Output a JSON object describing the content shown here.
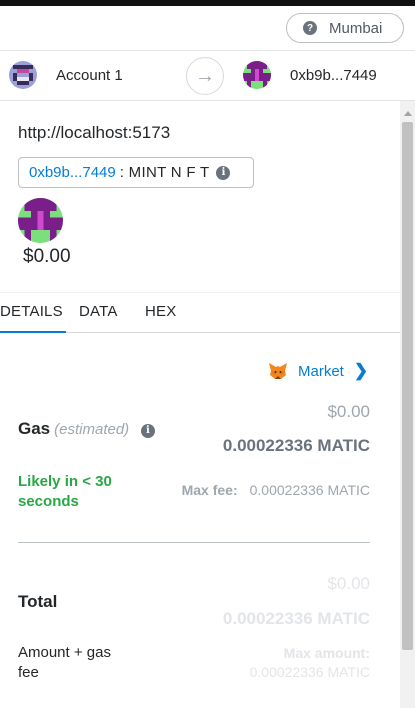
{
  "network": {
    "label": "Mumbai",
    "help_glyph": "?"
  },
  "accounts": {
    "from_label": "Account 1",
    "to_label": "0xb9b...7449",
    "arrow_glyph": "→"
  },
  "request": {
    "origin": "http://localhost:5173",
    "contract_address": "0xb9b...7449",
    "method": ": MINT N F T",
    "info_glyph": "i",
    "fiat_amount": "$0.00"
  },
  "tabs": [
    {
      "label": "DETAILS",
      "active": true
    },
    {
      "label": "DATA",
      "active": false
    },
    {
      "label": "HEX",
      "active": false
    }
  ],
  "details": {
    "market_label": "Market",
    "chevron_glyph": "❯",
    "gas_label": "Gas",
    "gas_estimated": "(estimated)",
    "gas_info_glyph": "i",
    "gas_fiat": "$0.00",
    "gas_matic": "0.00022336 MATIC",
    "likely_text": "Likely in < 30 seconds",
    "max_fee_label": "Max fee:",
    "max_fee_value": "0.00022336 MATIC",
    "total_label": "Total",
    "total_fiat": "$0.00",
    "total_matic": "0.00022336 MATIC",
    "amount_gas_label": "Amount + gas fee",
    "max_amount_label": "Max amount:",
    "max_amount_value": "0.00022336 MATIC"
  },
  "colors": {
    "accent": "#037dd6",
    "success": "#28a745",
    "muted": "#9fa6ae"
  }
}
